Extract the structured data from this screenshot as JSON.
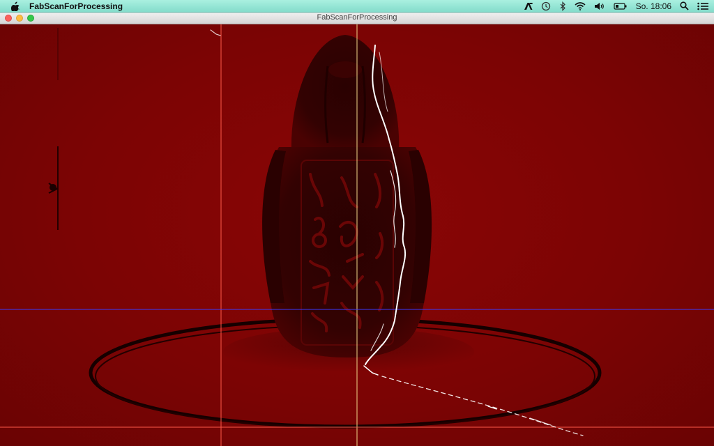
{
  "menubar": {
    "app_name": "FabScanForProcessing",
    "clock": "So. 18:06",
    "icons": [
      "apple-icon",
      "adobe-icon",
      "time-machine-icon",
      "bluetooth-icon",
      "wifi-icon",
      "volume-icon",
      "battery-icon",
      "spotlight-icon",
      "notification-list-icon"
    ]
  },
  "window": {
    "title": "FabScanForProcessing"
  },
  "colors": {
    "background_red": "#7c0404",
    "laser_line": "#ffffff",
    "center_line": "#f3d98a",
    "guide_line_red": "#ff5a4a",
    "horizontal_guide_blue": "#3b3bff"
  }
}
